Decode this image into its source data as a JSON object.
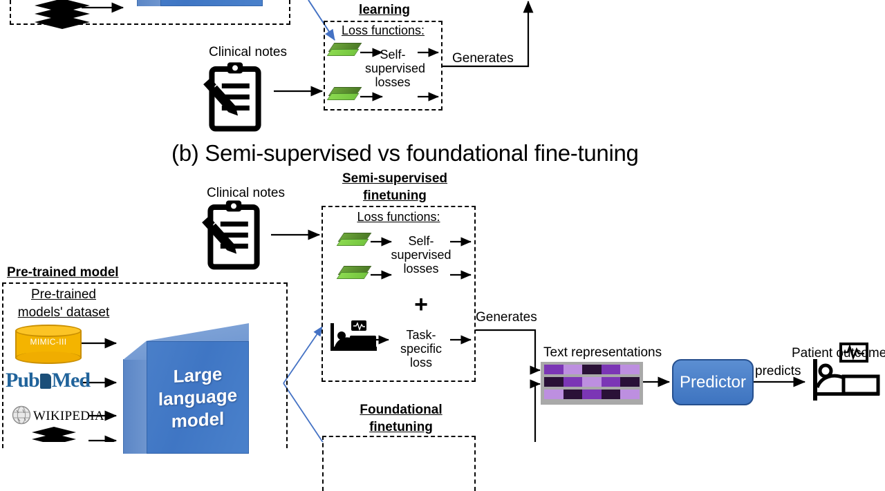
{
  "figure": {
    "section_caption": "(b) Semi-supervised vs foundational fine-tuning"
  },
  "top_section": {
    "heading_fragment": "learning",
    "loss_box": {
      "title": "Loss functions:",
      "loss_label_line1": "Self-",
      "loss_label_line2": "supervised",
      "loss_label_line3": "losses"
    },
    "clinical_notes_label": "Clinical notes",
    "generates_label": "Generates"
  },
  "semi_supervised": {
    "title_line1": "Semi-supervised",
    "title_line2": "finetuning",
    "clinical_notes_label": "Clinical notes",
    "loss_box": {
      "title": "Loss functions:",
      "self_supervised_line1": "Self-",
      "self_supervised_line2": "supervised",
      "self_supervised_line3": "losses",
      "plus_symbol": "+",
      "task_line1": "Task-",
      "task_line2": "specific",
      "task_line3": "loss"
    },
    "generates_label": "Generates"
  },
  "foundational": {
    "title_line1": "Foundational",
    "title_line2": "finetuning"
  },
  "pretrained_model": {
    "heading": "Pre-trained model",
    "dataset_title_line1": "Pre-trained",
    "dataset_title_line2": "models' dataset",
    "sources": [
      {
        "name": "MIMIC-III",
        "icon": "database-cylinder-icon"
      },
      {
        "name": "PubMed",
        "icon": "pubmed-logo-icon"
      },
      {
        "name": "WIKIPEDIA",
        "icon": "wikipedia-globe-icon"
      },
      {
        "name": "Books",
        "icon": "books-stack-icon"
      }
    ],
    "llm_line1": "Large",
    "llm_line2": "language",
    "llm_line3": "model"
  },
  "output": {
    "text_representations_label": "Text representations",
    "predictor_label": "Predictor",
    "predicts_label": "predicts",
    "patient_outcome_label": "Patient outcome"
  },
  "colors": {
    "llm_blue": "#3f76c4",
    "predictor_blue": "#3e74c0",
    "mimic_gold": "#f4b400",
    "arrow_blue": "#4472c4",
    "heat_bg": "#a9a9a9",
    "purple_dark": "#2a1137",
    "purple_mid": "#7b36b5",
    "purple_light": "#bd8fe0"
  },
  "chart_data": {
    "type": "heatmap",
    "title": "Text representations",
    "rows": 3,
    "cols": 5,
    "cells": [
      [
        "mid",
        "light",
        "dark",
        "mid",
        "light"
      ],
      [
        "dark",
        "mid",
        "light",
        "mid",
        "dark"
      ],
      [
        "light",
        "dark",
        "mid",
        "dark",
        "light"
      ]
    ],
    "palette": {
      "dark": "#2a1137",
      "mid": "#7b36b5",
      "light": "#bd8fe0"
    }
  }
}
